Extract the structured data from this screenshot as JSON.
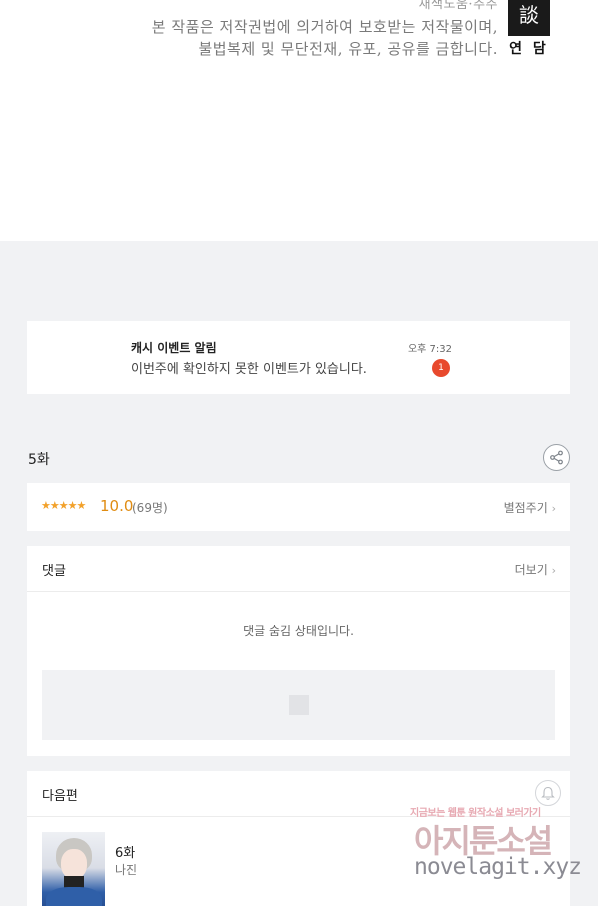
{
  "copyright": {
    "credit": "채색도움·추추",
    "line1": "본 작품은 저작권법에 의거하여 보호받는 저작물이며,",
    "line2": "불법복제 및 무단전재, 유포, 공유를 금합니다."
  },
  "publisher": {
    "name": "연 담"
  },
  "notification": {
    "title": "캐시 이벤트 알림",
    "message": "이번주에 확인하지 못한 이벤트가 있습니다.",
    "time": "오후 7:32",
    "badge_count": "1"
  },
  "episode": {
    "title": "5화"
  },
  "rating": {
    "stars": "★★★★★",
    "score": "10.0",
    "count": "(69명)",
    "rate_label": "별점주기"
  },
  "comments": {
    "header": "댓글",
    "more_label": "더보기",
    "hidden_message": "댓글 숨김 상태입니다."
  },
  "next_episode": {
    "header": "다음편",
    "title": "6화",
    "author": "나진"
  },
  "watermark": {
    "small": "지금보는 웹툰 원작소설 보러가기",
    "big": "아지툰소설",
    "url": "novelagit.xyz"
  },
  "icons": {
    "share": "share-icon",
    "bell": "bell-icon",
    "chevron": "chevron-right-icon"
  },
  "colors": {
    "badge": "#e8492d",
    "rating": "#e08c12",
    "page_background": "#f1f2f4"
  }
}
